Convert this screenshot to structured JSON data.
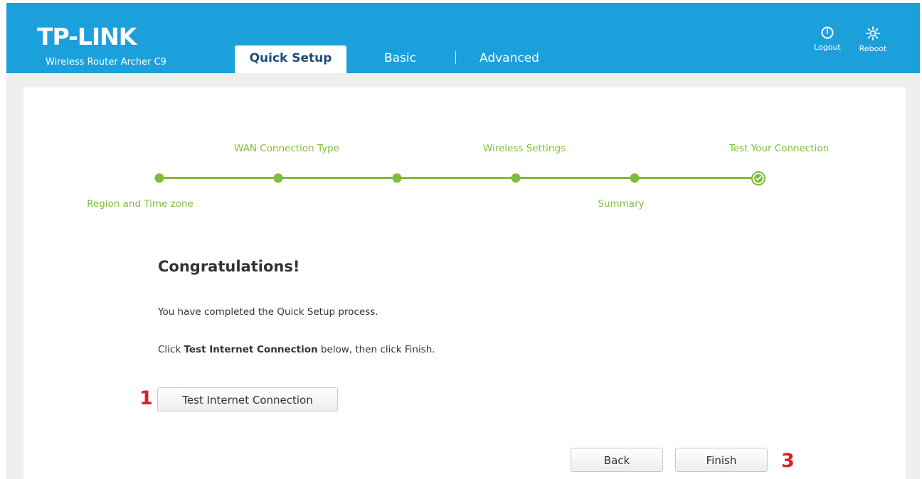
{
  "header": {
    "logo": "TP-LINK",
    "model": "Wireless Router Archer C9",
    "tabs": [
      {
        "label": "Quick Setup",
        "active": true
      },
      {
        "label": "Basic",
        "active": false
      },
      {
        "label": "Advanced",
        "active": false
      }
    ],
    "actions": {
      "logout": {
        "label": "Logout",
        "icon": "power-icon"
      },
      "reboot": {
        "label": "Reboot",
        "icon": "reboot-sun-icon"
      }
    },
    "color": "#1ca0dc"
  },
  "progress": {
    "steps_top": [
      "WAN Connection Type",
      "Wireless Settings",
      "Test Your Connection"
    ],
    "steps_bottom": [
      "Region and Time zone",
      "Summary"
    ],
    "accent": "#7ebd3c"
  },
  "message": {
    "heading": "Congratulations!",
    "line1": "You have completed the Quick Setup process.",
    "line2_prefix": "Click ",
    "line2_bold": "Test Internet Connection",
    "line2_suffix": " below, then click Finish."
  },
  "buttons": {
    "test": "Test Internet Connection",
    "back": "Back",
    "finish": "Finish"
  },
  "annotations": {
    "m1": "1",
    "m3": "3",
    "color": "#e02020"
  }
}
